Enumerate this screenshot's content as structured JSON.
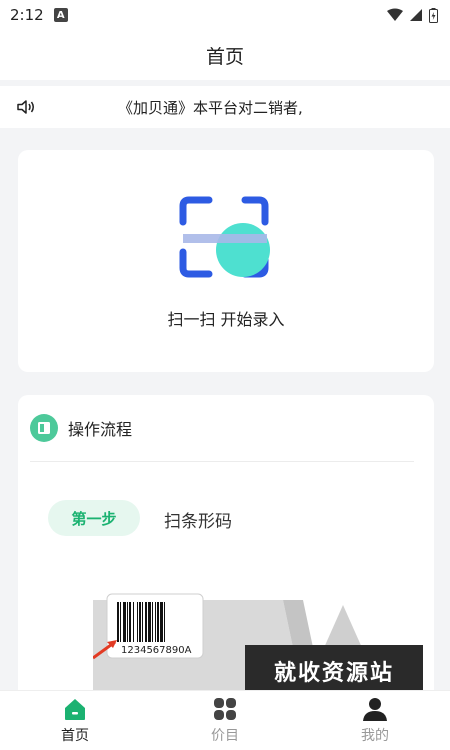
{
  "status_bar": {
    "time": "2:12",
    "app_badge": "A"
  },
  "header": {
    "title": "首页"
  },
  "notice": {
    "text": "《加贝通》本平台对二销者,"
  },
  "scan": {
    "label": "扫一扫 开始录入"
  },
  "process": {
    "title": "操作流程",
    "step_label": "第一步",
    "step_text": "扫条形码",
    "barcode_number": "1234567890A"
  },
  "watermark": {
    "text": "就收资源站"
  },
  "bottom_nav": {
    "items": [
      {
        "label": "首页",
        "icon": "home-icon",
        "active": true
      },
      {
        "label": "价目",
        "icon": "grid-icon",
        "active": false
      },
      {
        "label": "我的",
        "icon": "user-icon",
        "active": false
      }
    ]
  },
  "colors": {
    "accent": "#1bb271",
    "scan_blue": "#2d5be3",
    "scan_cyan": "#4ee0d0"
  }
}
